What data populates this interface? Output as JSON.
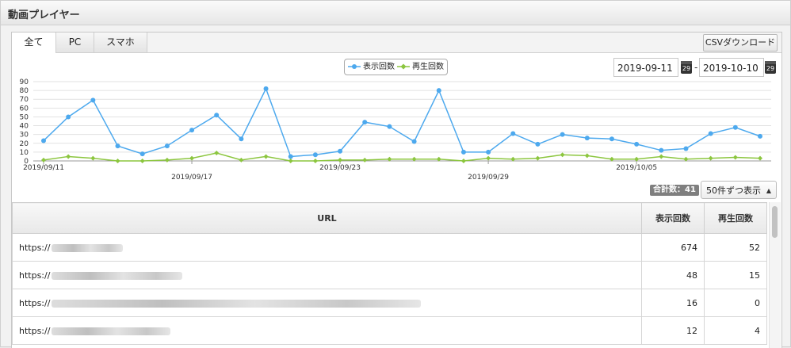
{
  "panel": {
    "title": "動画プレイヤー"
  },
  "tabs": [
    {
      "label": "全て",
      "active": true
    },
    {
      "label": "PC",
      "active": false
    },
    {
      "label": "スマホ",
      "active": false
    }
  ],
  "csv_button": {
    "label": "CSVダウンロード"
  },
  "date_range": {
    "start": "2019-09-11",
    "end": "2019-10-10",
    "separator": "-",
    "calendar_icon_label": "29"
  },
  "chart_data": {
    "type": "line",
    "x": [
      "2019/09/11",
      "2019/09/12",
      "2019/09/13",
      "2019/09/14",
      "2019/09/15",
      "2019/09/16",
      "2019/09/17",
      "2019/09/18",
      "2019/09/19",
      "2019/09/20",
      "2019/09/21",
      "2019/09/22",
      "2019/09/23",
      "2019/09/24",
      "2019/09/25",
      "2019/09/26",
      "2019/09/27",
      "2019/09/28",
      "2019/09/29",
      "2019/09/30",
      "2019/10/01",
      "2019/10/02",
      "2019/10/03",
      "2019/10/04",
      "2019/10/05",
      "2019/10/06",
      "2019/10/07",
      "2019/10/08",
      "2019/10/09",
      "2019/10/10"
    ],
    "tick_labels": [
      {
        "label": "2019/09/11",
        "index": 0
      },
      {
        "label": "2019/09/17",
        "index": 6
      },
      {
        "label": "2019/09/23",
        "index": 12
      },
      {
        "label": "2019/09/29",
        "index": 18
      },
      {
        "label": "2019/10/05",
        "index": 24
      }
    ],
    "yticks": [
      0,
      10,
      20,
      30,
      40,
      50,
      60,
      70,
      80,
      90
    ],
    "ylim": [
      0,
      90
    ],
    "grid": true,
    "legend_position": "top-center",
    "series": [
      {
        "name": "表示回数",
        "color": "#4da9ee",
        "values": [
          23,
          50,
          69,
          17,
          8,
          17,
          35,
          52,
          25,
          82,
          5,
          7,
          11,
          44,
          39,
          22,
          80,
          10,
          10,
          31,
          19,
          30,
          26,
          25,
          19,
          12,
          14,
          31,
          38,
          28
        ]
      },
      {
        "name": "再生回数",
        "color": "#8cc63f",
        "values": [
          1,
          5,
          3,
          0,
          0,
          1,
          3,
          9,
          1,
          5,
          0,
          0,
          1,
          1,
          2,
          2,
          2,
          0,
          3,
          2,
          3,
          7,
          6,
          2,
          2,
          5,
          2,
          3,
          4,
          3
        ]
      }
    ]
  },
  "summary": {
    "total_label": "合計数：41"
  },
  "page_size": {
    "selected": "50件ずつ表示"
  },
  "table": {
    "headers": {
      "url": "URL",
      "views": "表示回数",
      "plays": "再生回数"
    },
    "rows": [
      {
        "url": "https://",
        "views": "674",
        "plays": "52",
        "blur_width": 90
      },
      {
        "url": "https://",
        "views": "48",
        "plays": "15",
        "blur_width": 165
      },
      {
        "url": "https://",
        "views": "16",
        "plays": "0",
        "blur_width": 466
      },
      {
        "url": "https://",
        "views": "12",
        "plays": "4",
        "blur_width": 150
      }
    ]
  }
}
